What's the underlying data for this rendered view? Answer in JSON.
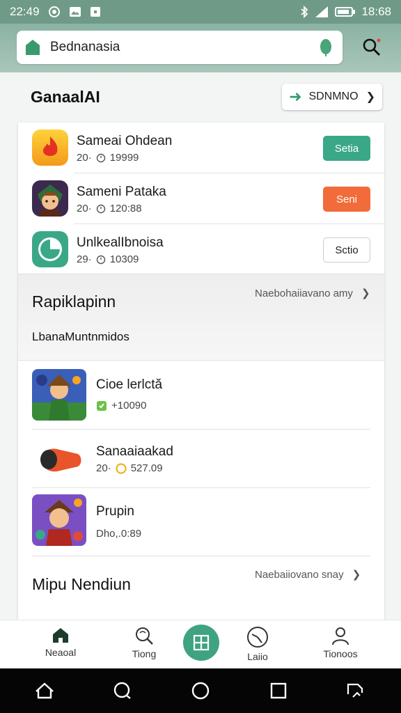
{
  "status_bar": {
    "time": "22:49",
    "right_time": "18:68"
  },
  "search": {
    "text": "Bednanasia"
  },
  "section": {
    "title": "GanaalAI",
    "top_button_label": "SDNMNO"
  },
  "top_list": [
    {
      "name": "Sameai Ohdean",
      "rank": "20·",
      "count": "19999",
      "button": "Setia",
      "button_color": "#3aa886"
    },
    {
      "name": "Sameni Pataka",
      "rank": "20·",
      "count": "120:88",
      "button": "Seni",
      "button_color": "#f26b3a"
    },
    {
      "name": "UnlkealIbnoisa",
      "rank": "29·",
      "count": "10309",
      "button": "Sctio",
      "button_color": "#ffffff"
    }
  ],
  "band": {
    "title": "Rapiklapinn",
    "more": "Naebohaiiavano amy",
    "subtitle": "LbanaMuntnmidos"
  },
  "recommend_list": [
    {
      "name": "Cioe lerlctă",
      "meta": "+10090"
    },
    {
      "name": "Sanaaiaakad",
      "rank": "20·",
      "meta": "527.09"
    },
    {
      "name": "Prupin",
      "meta": "Dho,.0:89"
    }
  ],
  "footer_section": {
    "title": "Mipu Nendiun",
    "more": "Naebaiiovano snay"
  },
  "bottom_nav": [
    {
      "label": "Neaoal",
      "icon": "home-icon"
    },
    {
      "label": "Tiong",
      "icon": "search-icon"
    },
    {
      "label": "",
      "icon": "grid-icon"
    },
    {
      "label": "Laiio",
      "icon": "clock-icon"
    },
    {
      "label": "Tionoos",
      "icon": "profile-icon"
    }
  ]
}
